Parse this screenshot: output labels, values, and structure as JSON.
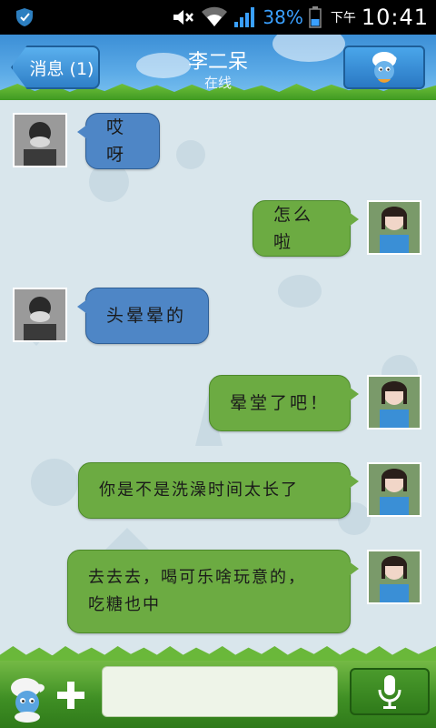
{
  "statusbar": {
    "battery": "38%",
    "ampm": "下午",
    "time": "10:41",
    "icons": [
      "shield-icon",
      "mute-icon",
      "wifi-icon",
      "signal-icon",
      "battery-icon"
    ]
  },
  "header": {
    "back_label": "消息 (1)",
    "contact_name": "李二呆",
    "contact_status": "在线",
    "profile_icon": "smurf-avatar-icon"
  },
  "colors": {
    "incoming_bubble": "#4e86c6",
    "outgoing_bubble": "#6cab42",
    "header_blue": "#3c8fd6",
    "grass_green": "#3f8f24"
  },
  "messages": [
    {
      "side": "left",
      "text": "哎呀"
    },
    {
      "side": "right",
      "text": "怎么啦"
    },
    {
      "side": "left",
      "text": "头晕晕的"
    },
    {
      "side": "right",
      "text": "晕堂了吧！"
    },
    {
      "side": "right",
      "text": "你是不是洗澡时间太长了"
    },
    {
      "side": "right",
      "text": "去去去，喝可乐啥玩意的，吃糖也中"
    }
  ],
  "inputbar": {
    "placeholder": "",
    "icons": [
      "smurf-icon",
      "plus-icon",
      "microphone-icon"
    ]
  }
}
